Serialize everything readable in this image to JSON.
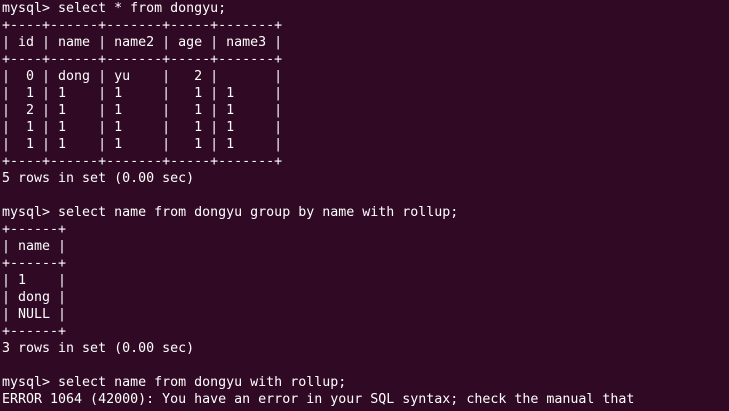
{
  "terminal": {
    "background": "#300a24",
    "foreground": "#ffffff",
    "lines": [
      {
        "text": "mysql> select * from dongyu;",
        "kind": "prompt"
      },
      {
        "text": "+----+------+-------+-----+-------+",
        "kind": "border"
      },
      {
        "text": "| id | name | name2 | age | name3 |",
        "kind": "header"
      },
      {
        "text": "+----+------+-------+-----+-------+",
        "kind": "border"
      },
      {
        "text": "|  0 | dong | yu    |   2 |       |",
        "kind": "row"
      },
      {
        "text": "|  1 | 1    | 1     |   1 | 1     |",
        "kind": "row"
      },
      {
        "text": "|  2 | 1    | 1     |   1 | 1     |",
        "kind": "row"
      },
      {
        "text": "|  1 | 1    | 1     |   1 | 1     |",
        "kind": "row"
      },
      {
        "text": "|  1 | 1    | 1     |   1 | 1     |",
        "kind": "row"
      },
      {
        "text": "+----+------+-------+-----+-------+",
        "kind": "border"
      },
      {
        "text": "5 rows in set (0.00 sec)",
        "kind": "status"
      },
      {
        "text": "",
        "kind": "blank"
      },
      {
        "text": "mysql> select name from dongyu group by name with rollup;",
        "kind": "prompt"
      },
      {
        "text": "+------+",
        "kind": "border"
      },
      {
        "text": "| name |",
        "kind": "header"
      },
      {
        "text": "+------+",
        "kind": "border"
      },
      {
        "text": "| 1    |",
        "kind": "row"
      },
      {
        "text": "| dong |",
        "kind": "row"
      },
      {
        "text": "| NULL |",
        "kind": "row"
      },
      {
        "text": "+------+",
        "kind": "border"
      },
      {
        "text": "3 rows in set (0.00 sec)",
        "kind": "status"
      },
      {
        "text": "",
        "kind": "blank"
      },
      {
        "text": "mysql> select name from dongyu with rollup;",
        "kind": "prompt"
      },
      {
        "text": "ERROR 1064 (42000): You have an error in your SQL syntax; check the manual that",
        "kind": "error"
      }
    ]
  }
}
